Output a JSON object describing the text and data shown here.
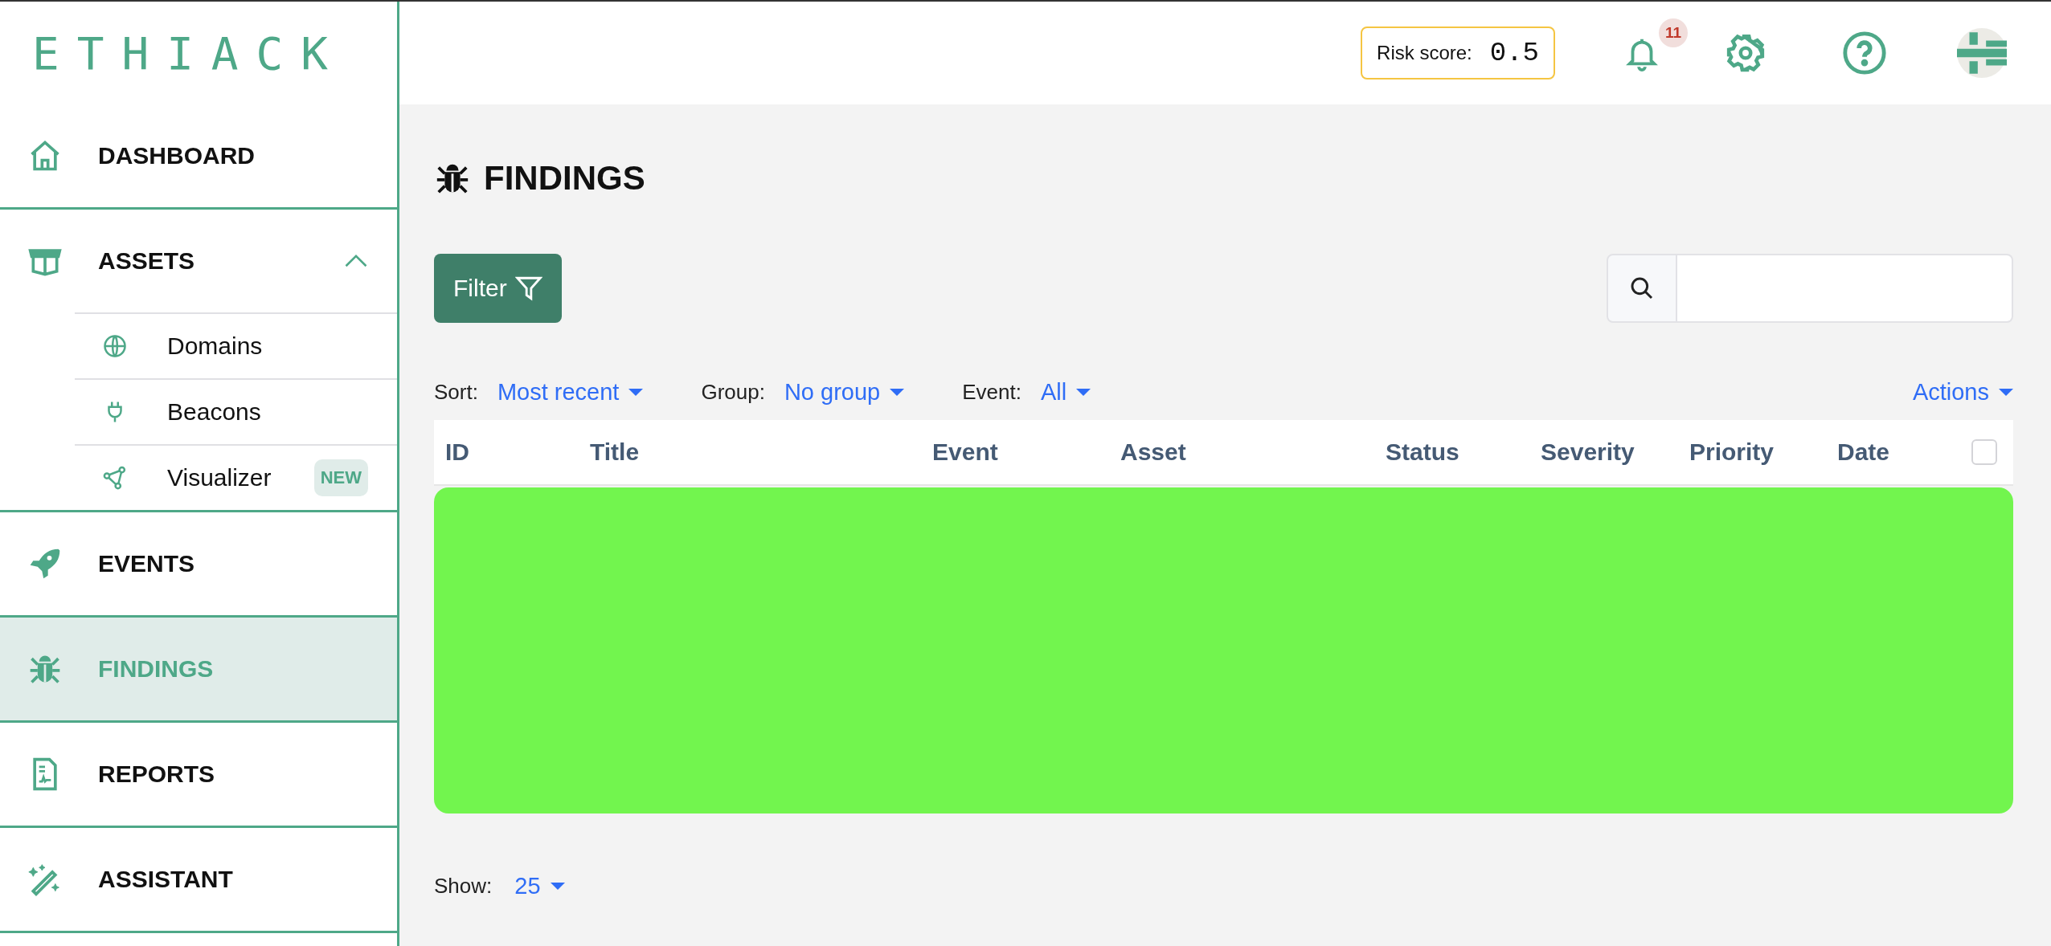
{
  "logo": "ETHIACK",
  "header": {
    "risk_label": "Risk score:",
    "risk_value": "0.5",
    "notification_count": "11"
  },
  "sidebar": {
    "items": [
      {
        "label": "DASHBOARD",
        "selected": false
      },
      {
        "label": "ASSETS",
        "selected": false,
        "expanded": true,
        "children": [
          {
            "label": "Domains",
            "selected": false
          },
          {
            "label": "Beacons",
            "selected": false
          },
          {
            "label": "Visualizer",
            "selected": false,
            "badge": "NEW"
          }
        ]
      },
      {
        "label": "EVENTS",
        "selected": false
      },
      {
        "label": "FINDINGS",
        "selected": true
      },
      {
        "label": "REPORTS",
        "selected": false
      },
      {
        "label": "ASSISTANT",
        "selected": false
      }
    ]
  },
  "page": {
    "title": "FINDINGS",
    "filter_button": "Filter",
    "controls": [
      {
        "label": "Sort:",
        "value": "Most recent"
      },
      {
        "label": "Group:",
        "value": "No group"
      },
      {
        "label": "Event:",
        "value": "All"
      }
    ],
    "actions": "Actions",
    "table": {
      "columns": [
        "ID",
        "Title",
        "Event",
        "Asset",
        "Status",
        "Severity",
        "Priority",
        "Date"
      ],
      "select_all_checked": false
    },
    "show": {
      "label": "Show:",
      "value": "25"
    }
  }
}
